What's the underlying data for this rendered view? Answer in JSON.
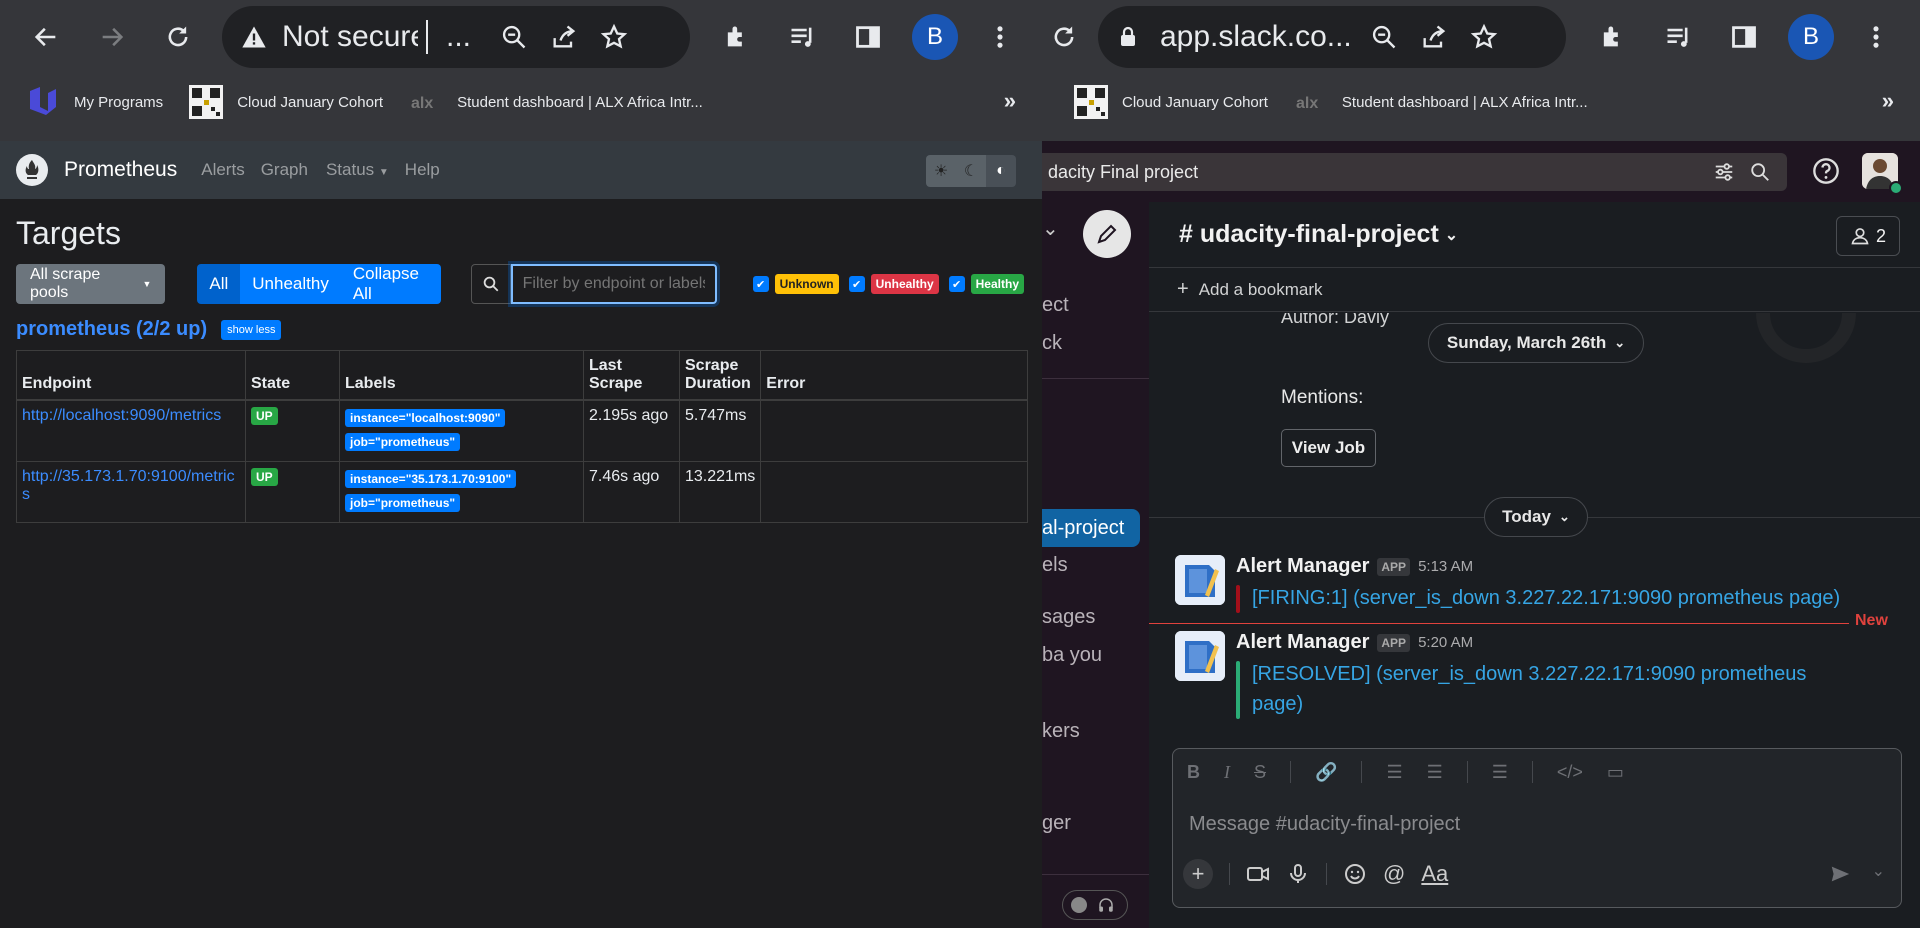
{
  "left_browser": {
    "omnibox": {
      "security": "Not secure",
      "url": "..."
    },
    "avatar": "B",
    "bookmarks": [
      {
        "label": "My Programs"
      },
      {
        "label": "Cloud January Cohort"
      },
      {
        "label": "Student dashboard | ALX Africa Intr..."
      }
    ],
    "more": "»"
  },
  "prometheus": {
    "brand": "Prometheus",
    "nav": [
      "Alerts",
      "Graph",
      "Status",
      "Help"
    ],
    "title": "Targets",
    "scrape_pools": "All scrape pools",
    "toggle": [
      "All",
      "Unhealthy",
      "Collapse All"
    ],
    "search_placeholder": "Filter by endpoint or labels",
    "filters": [
      {
        "label": "Unknown",
        "color": "#ffc107",
        "text": "#222"
      },
      {
        "label": "Unhealthy",
        "color": "#dc3545",
        "text": "#fff"
      },
      {
        "label": "Healthy",
        "color": "#28a745",
        "text": "#fff"
      }
    ],
    "pool_title": "prometheus (2/2 up)",
    "show_less": "show less",
    "table": {
      "headers": [
        "Endpoint",
        "State",
        "Labels",
        "Last Scrape",
        "Scrape Duration",
        "Error"
      ],
      "rows": [
        {
          "endpoint": "http://localhost:9090/metrics",
          "state": "UP",
          "labels": [
            "instance=\"localhost:9090\"",
            "job=\"prometheus\""
          ],
          "last_scrape": "2.195s ago",
          "duration": "5.747ms",
          "error": ""
        },
        {
          "endpoint": "http://35.173.1.70:9100/metrics",
          "state": "UP",
          "labels": [
            "instance=\"35.173.1.70:9100\"",
            "job=\"prometheus\""
          ],
          "last_scrape": "7.46s ago",
          "duration": "13.221ms",
          "error": ""
        }
      ]
    }
  },
  "right_browser": {
    "omnibox": {
      "url": "app.slack.co..."
    },
    "avatar": "B",
    "bookmarks": [
      {
        "label": "Cloud January Cohort"
      },
      {
        "label": "Student dashboard | ALX Africa Intr..."
      }
    ],
    "more": "»"
  },
  "slack": {
    "search": "dacity Final project",
    "sidebar": [
      "ect",
      "ck",
      "al-project",
      "els",
      "sages",
      "ba  you",
      "kers",
      "ger"
    ],
    "channel": "# udacity-final-project",
    "members": "2",
    "add_bookmark": "Add a bookmark",
    "author_partial": "Author: Daviy",
    "date1": "Sunday, March 26th",
    "mentions": "Mentions:",
    "view_job": "View Job",
    "date2": "Today",
    "new_label": "New",
    "messages": [
      {
        "name": "Alert Manager",
        "badge": "APP",
        "time": "5:13 AM",
        "text": "[FIRING:1]  (server_is_down 3.227.22.171:9090 prometheus page)",
        "bar": "#a30f1a"
      },
      {
        "name": "Alert Manager",
        "badge": "APP",
        "time": "5:20 AM",
        "text": "[RESOLVED]  (server_is_down 3.227.22.171:9090 prometheus page)",
        "bar": "#2bac76"
      }
    ],
    "composer_placeholder": "Message #udacity-final-project",
    "format_aa": "Aa"
  }
}
